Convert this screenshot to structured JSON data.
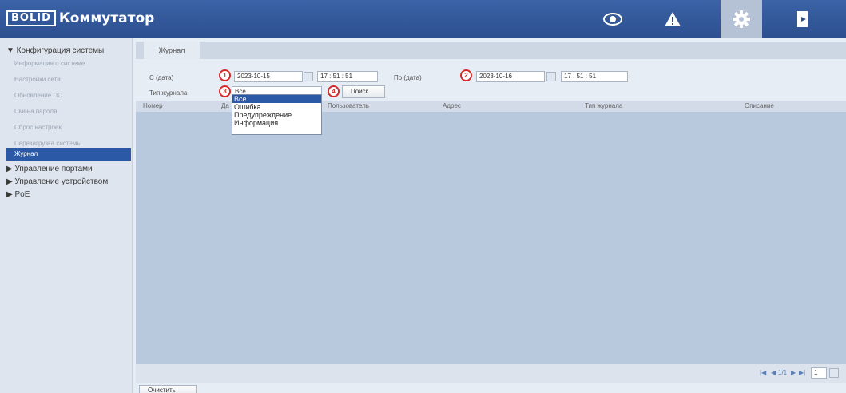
{
  "header": {
    "logo_text": "BOLID",
    "title": "Коммутатор",
    "icons": [
      "eye-icon",
      "warning-icon",
      "gear-icon",
      "exit-icon"
    ]
  },
  "sidebar": {
    "group_system": "▼ Конфигурация системы",
    "items": [
      "Информация о системе",
      "Настройки сети",
      "Обновление ПО",
      "Смена пароля",
      "Сброс настроек",
      "Перезагрузка системы",
      "Журнал"
    ],
    "group_ports": "▶ Управление портами",
    "group_device": "▶ Управление устройством",
    "group_poe": "▶ PoE"
  },
  "tab": {
    "label": "Журнал"
  },
  "form": {
    "from_label": "С (дата)",
    "from_date": "2023-10-15",
    "from_time": "17 :  51 :  51",
    "to_label": "По (дата)",
    "to_date": "2023-10-16",
    "to_time": "17 :  51 :  51",
    "type_label": "Тип журнала",
    "type_value": "Все",
    "search_button": "Поиск"
  },
  "badges": [
    "1",
    "2",
    "3",
    "4"
  ],
  "dropdown": {
    "options": [
      "Все",
      "Ошибка",
      "Предупреждение",
      "Информация"
    ]
  },
  "table": {
    "columns": [
      "Номер",
      "Да",
      "Пользователь",
      "Адрес",
      "Тип журнала",
      "Описание"
    ]
  },
  "pager": {
    "text": "1/1",
    "page_input": "1"
  },
  "footer": {
    "clear_button": "Очистить"
  },
  "colors": {
    "header": "#2c4f8f",
    "accent": "#2c59a6",
    "badge": "#d42a2a"
  }
}
